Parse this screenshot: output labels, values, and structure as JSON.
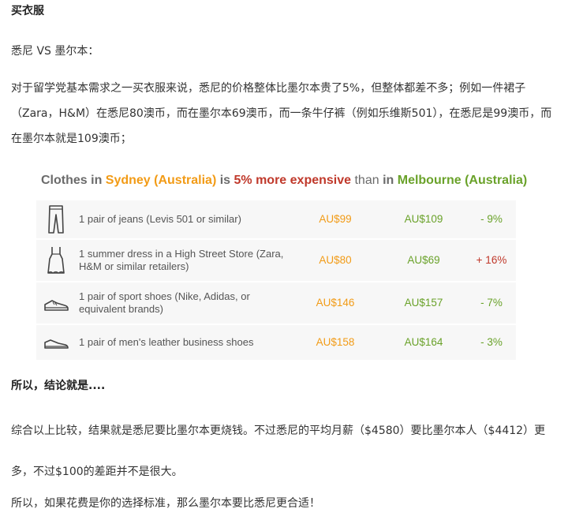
{
  "heading": "买衣服",
  "subheading": "悉尼 VS 墨尔本：",
  "intro": "对于留学党基本需求之一买衣服来说，悉尼的价格整体比墨尔本贵了5%，但整体都差不多；例如一件裙子（Zara，H&M）在悉尼80澳币，而在墨尔本69澳币，而一条牛仔裤（例如乐维斯501），在悉尼是99澳币，而在墨尔本就是109澳币；",
  "card": {
    "title_parts": {
      "a": "Clothes in ",
      "city1": "Sydney (Australia)",
      "b": " is ",
      "pct": "5% more expensive",
      "c": " than ",
      "d": "in ",
      "city2": "Melbourne (Australia)"
    },
    "rows": [
      {
        "icon": "jeans-icon",
        "desc": "1 pair of jeans (Levis 501 or similar)",
        "sydney": "AU$99",
        "melbourne": "AU$109",
        "diff": "- 9%",
        "sign": "neg"
      },
      {
        "icon": "dress-icon",
        "desc": "1 summer dress in a High Street Store (Zara, H&M or similar retailers)",
        "sydney": "AU$80",
        "melbourne": "AU$69",
        "diff": "+ 16%",
        "sign": "pos"
      },
      {
        "icon": "sport-shoe-icon",
        "desc": "1 pair of sport shoes (Nike, Adidas, or equivalent brands)",
        "sydney": "AU$146",
        "melbourne": "AU$157",
        "diff": "- 7%",
        "sign": "neg"
      },
      {
        "icon": "leather-shoe-icon",
        "desc": "1 pair of men's leather business shoes",
        "sydney": "AU$158",
        "melbourne": "AU$164",
        "diff": "- 3%",
        "sign": "neg"
      }
    ]
  },
  "conclusion_heading": "所以，结论就是....",
  "conclusion_1": "综合以上比较，结果就是悉尼要比墨尔本更烧钱。不过悉尼的平均月薪（$4580）要比墨尔本人（$4412）更多，不过$100的差距并不是很大。",
  "conclusion_2": "所以，如果花费是你的选择标准，那么墨尔本要比悉尼更合适！"
}
